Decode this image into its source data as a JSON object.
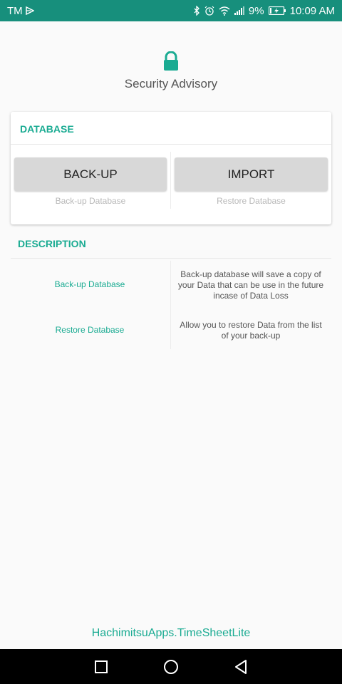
{
  "status_bar": {
    "carrier": "TM",
    "battery": "9%",
    "time": "10:09 AM"
  },
  "header": {
    "title": "Security Advisory"
  },
  "database_card": {
    "heading": "DATABASE",
    "backup_button": "BACK-UP",
    "backup_caption": "Back-up Database",
    "import_button": "IMPORT",
    "import_caption": "Restore Database"
  },
  "description": {
    "heading": "DESCRIPTION",
    "rows": [
      {
        "name": "Back-up Database",
        "text": "Back-up database will save a copy of your Data that can be use in the future incase of Data Loss"
      },
      {
        "name": "Restore Database",
        "text": "Allow you to restore Data from the list of your back-up"
      }
    ]
  },
  "footer": {
    "app_id": "HachimitsuApps.TimeSheetLite"
  },
  "colors": {
    "accent": "#1aab92",
    "status_bar": "#178f7c",
    "button": "#d8d8d8"
  }
}
